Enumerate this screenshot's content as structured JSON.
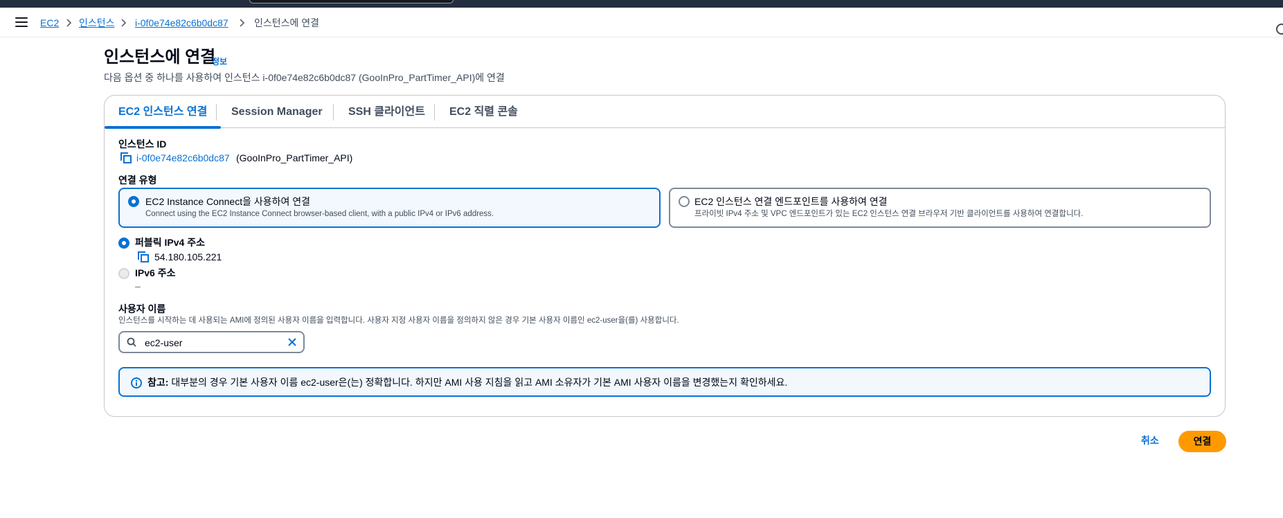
{
  "breadcrumb": {
    "items": [
      "EC2",
      "인스턴스",
      "i-0f0e74e82c6b0dc87"
    ],
    "current": "인스턴스에 연결"
  },
  "page": {
    "title": "인스턴스에 연결",
    "info": "정보",
    "description": "다음 옵션 중 하나를 사용하여 인스턴스 i-0f0e74e82c6b0dc87 (GooInPro_PartTimer_API)에 연결"
  },
  "tabs": [
    {
      "label": "EC2 인스턴스 연결",
      "active": true
    },
    {
      "label": "Session Manager",
      "active": false
    },
    {
      "label": "SSH 클라이언트",
      "active": false
    },
    {
      "label": "EC2 직렬 콘솔",
      "active": false
    }
  ],
  "instance": {
    "label": "인스턴스 ID",
    "id": "i-0f0e74e82c6b0dc87",
    "name": "(GooInPro_PartTimer_API)"
  },
  "connection_type": {
    "label": "연결 유형",
    "options": [
      {
        "title": "EC2 Instance Connect을 사용하여 연결",
        "desc": "Connect using the EC2 Instance Connect browser-based client, with a public IPv4 or IPv6 address.",
        "selected": true
      },
      {
        "title": "EC2 인스턴스 연결 엔드포인트를 사용하여 연결",
        "desc": "프라이빗 IPv4 주소 및 VPC 엔드포인트가 있는 EC2 인스턴스 연결 브라우저 기반 클라이언트를 사용하여 연결합니다.",
        "selected": false
      }
    ]
  },
  "address": {
    "ipv4_label": "퍼블릭 IPv4 주소",
    "ipv4_value": "54.180.105.221",
    "ipv6_label": "IPv6 주소",
    "ipv6_value": "–"
  },
  "username": {
    "label": "사용자 이름",
    "desc": "인스턴스를 시작하는 데 사용되는 AMI에 정의된 사용자 이름을 입력합니다. 사용자 지정 사용자 이름을 정의하지 않은 경우 기본 사용자 이름인 ec2-user을(를) 사용합니다.",
    "value": "ec2-user"
  },
  "note": {
    "prefix": "참고:",
    "text": " 대부분의 경우 기본 사용자 이름 ec2-user은(는) 정확합니다. 하지만 AMI 사용 지침을 읽고 AMI 소유자가 기본 AMI 사용자 이름을 변경했는지 확인하세요."
  },
  "actions": {
    "cancel": "취소",
    "connect": "연결"
  },
  "colors": {
    "accent": "#0972d3",
    "primary_button": "#ff9900",
    "topbar": "#232f3e"
  }
}
